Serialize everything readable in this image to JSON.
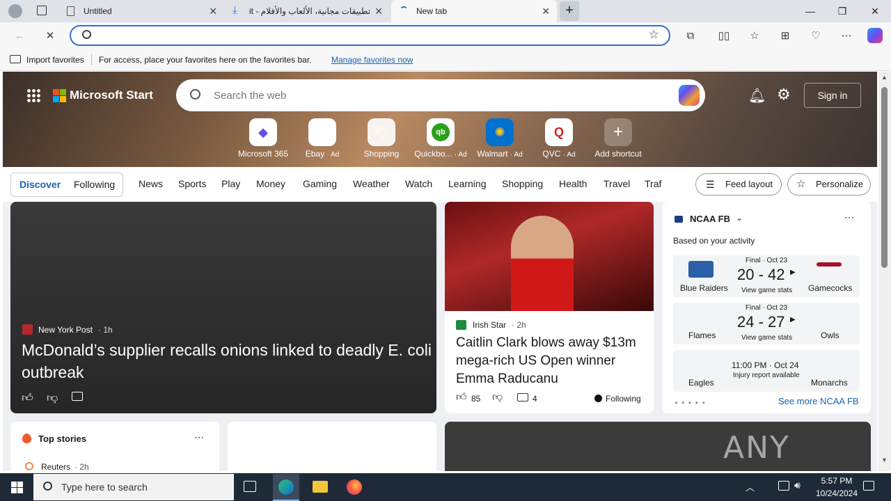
{
  "tabs": [
    {
      "title": "Untitled"
    },
    {
      "title": "تطبيقات مجانية، الألعاب والأفلام - ‎it"
    },
    {
      "title": "New tab"
    }
  ],
  "address": {
    "value": "",
    "placeholder": ""
  },
  "favorites": {
    "import": "Import favorites",
    "hint": "For access, place your favorites here on the favorites bar.",
    "manage": "Manage favorites now"
  },
  "msn": {
    "brand": "Microsoft Start",
    "search_placeholder": "Search the web",
    "signin": "Sign in"
  },
  "shortcuts": [
    {
      "label": "Microsoft 365",
      "ad": ""
    },
    {
      "label": "Ebay",
      "ad": "· Ad"
    },
    {
      "label": "Shopping",
      "ad": ""
    },
    {
      "label": "Quickbo...",
      "ad": "· Ad"
    },
    {
      "label": "Walmart",
      "ad": "· Ad"
    },
    {
      "label": "QVC",
      "ad": "· Ad"
    },
    {
      "label": "Add shortcut",
      "ad": ""
    }
  ],
  "nav": {
    "discover": "Discover",
    "following": "Following",
    "items": [
      "News",
      "Sports",
      "Play",
      "Money",
      "Gaming",
      "Weather",
      "Watch",
      "Learning",
      "Shopping",
      "Health",
      "Travel",
      "Traf"
    ],
    "feed_layout": "Feed layout",
    "personalize": "Personalize"
  },
  "main_story": {
    "source": "New York Post",
    "age": "· 1h",
    "headline": "McDonald’s supplier recalls onions linked to deadly E. coli outbreak"
  },
  "second_story": {
    "source": "Irish Star",
    "age": "· 2h",
    "headline": "Caitlin Clark blows away $13m mega-rich US Open winner Emma Raducanu",
    "likes": "85",
    "comments": "4",
    "following": "Following"
  },
  "ncaa": {
    "title": "NCAA FB",
    "subtitle": "Based on your activity",
    "games": [
      {
        "status": "Final · Oct 23",
        "score": "20 - 42",
        "link": "View game stats",
        "home": "Blue Raiders",
        "away": "Gamecocks"
      },
      {
        "status": "Final · Oct 23",
        "score": "24 - 27",
        "link": "View game stats",
        "home": "Flames",
        "away": "Owls"
      },
      {
        "status": "11:00 PM · Oct 24",
        "score": "",
        "link": "Injury report available",
        "home": "Eagles",
        "away": "Monarchs"
      }
    ],
    "more": "See more NCAA FB"
  },
  "top_stories": {
    "title": "Top stories",
    "source": "Reuters",
    "age": "· 2h"
  },
  "watermark": "ANY RUN",
  "taskbar": {
    "search_placeholder": "Type here to search",
    "time": "5:57 PM",
    "date": "10/24/2024"
  }
}
